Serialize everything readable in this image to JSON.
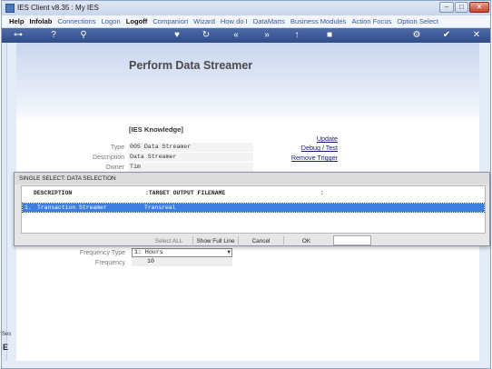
{
  "window": {
    "title": "IES Client v8.35 : My IES"
  },
  "menu": [
    "Help",
    "Infolab",
    "Connections",
    "Logon",
    "Logoff",
    "Companion",
    "Wizard",
    "How do I",
    "DataMarts",
    "Business Modules",
    "Action Focus",
    "Option Select"
  ],
  "toolbar": {
    "icons": [
      "key-icon",
      "help-icon",
      "search-icon",
      "favorite-icon",
      "refresh-icon",
      "back-icon",
      "forward-icon",
      "upload-icon",
      "stop-icon",
      "settings-icon",
      "ok-icon",
      "close-icon"
    ]
  },
  "page": {
    "title": "Perform Data Streamer"
  },
  "knowledge": {
    "section": "[IES Knowledge]",
    "type_label": "Type",
    "type_value": "005 Data Streamer",
    "description_label": "Description",
    "description_value": "Data Streamer",
    "owner_label": "Owner",
    "owner_value": "Tim"
  },
  "actions": {
    "update": "Update",
    "debug": "Debug / Test",
    "remove_trigger": "Remove Trigger"
  },
  "frequency": {
    "type_label": "Frequency Type",
    "type_value": "1: Hours",
    "frequency_label": "Frequency",
    "frequency_value": "10"
  },
  "dialog": {
    "title": "SINGLE SELECT: DATA SELECTION",
    "columns": [
      "DESCRIPTION",
      ":TARGET OUTPUT FILENAME",
      ":"
    ],
    "rows": [
      {
        "num": "1.",
        "description": "Transaction Streamer",
        "filename": "Transreal"
      }
    ],
    "buttons": {
      "select_all": "Select ALL",
      "show_full_line": "Show Full Line",
      "cancel": "Cancel",
      "ok": "OK"
    },
    "search_value": ""
  },
  "sidebar": {
    "label": "Ses",
    "icon": "e-icon"
  }
}
